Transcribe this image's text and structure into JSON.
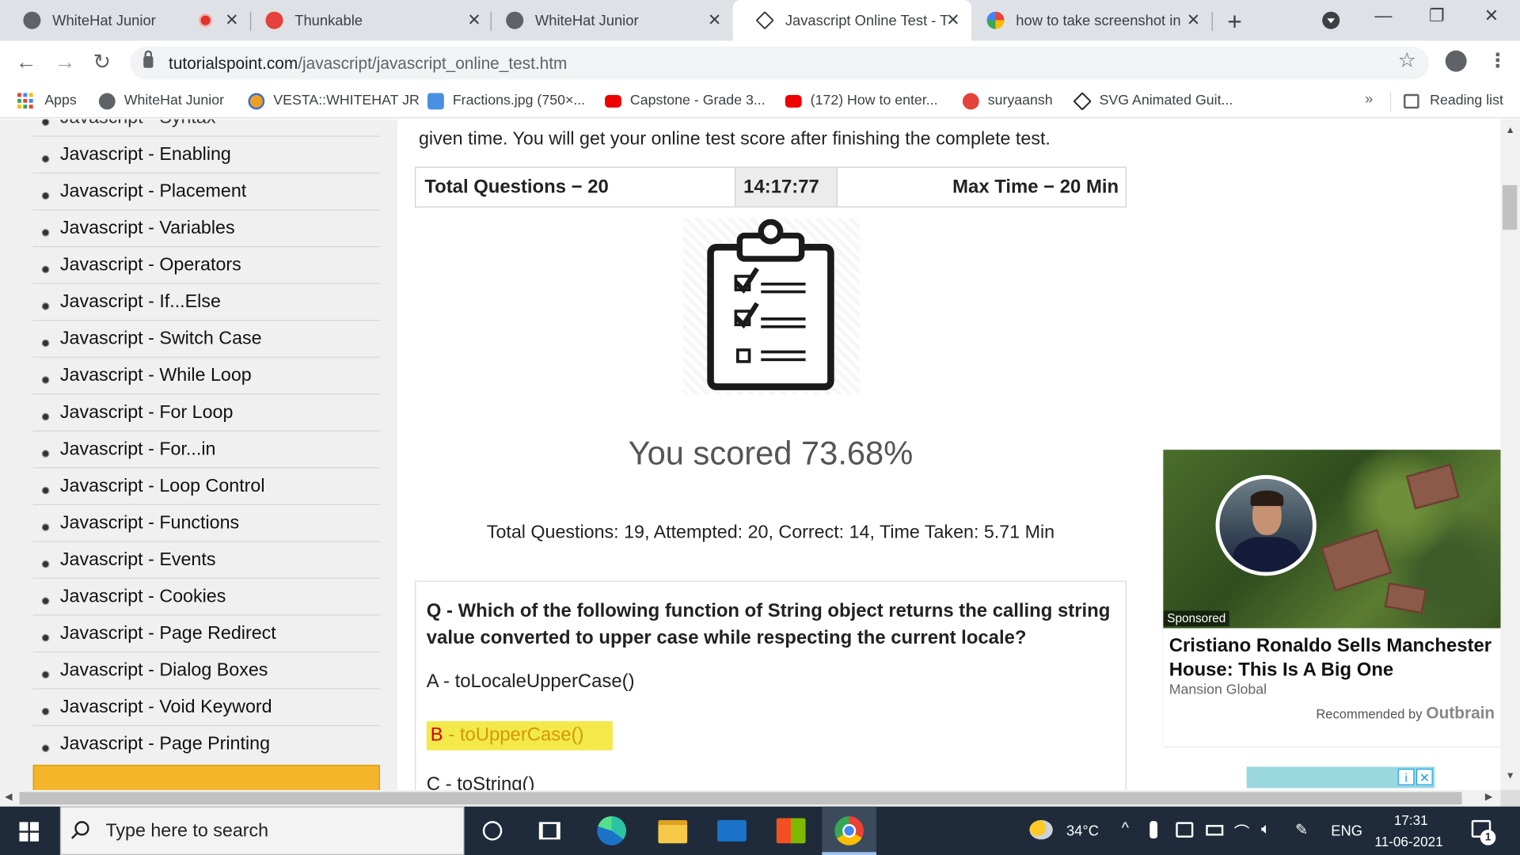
{
  "browser": {
    "tabs": [
      {
        "title": "WhiteHat Junior",
        "active": false,
        "recording": true
      },
      {
        "title": "Thunkable",
        "active": false
      },
      {
        "title": "WhiteHat Junior",
        "active": false
      },
      {
        "title": "Javascript Online Test - Tu",
        "active": true
      },
      {
        "title": "how to take screenshot in",
        "active": false
      }
    ],
    "new_tab": "+",
    "window_controls": {
      "minimize": "—",
      "restore": "❐",
      "close": "✕"
    },
    "url_host": "tutorialspoint.com",
    "url_path": "/javascript/javascript_online_test.htm",
    "bookmarks": [
      {
        "label": "Apps"
      },
      {
        "label": "WhiteHat Junior"
      },
      {
        "label": "VESTA::WHITEHAT JR"
      },
      {
        "label": "Fractions.jpg (750×..."
      },
      {
        "label": "Capstone - Grade 3..."
      },
      {
        "label": "(172) How to enter..."
      },
      {
        "label": "suryaansh"
      },
      {
        "label": "SVG Animated Guit..."
      }
    ],
    "bookmarks_more": "»",
    "reading_list": "Reading list"
  },
  "sidebar": {
    "items": [
      "Javascript - Syntax",
      "Javascript - Enabling",
      "Javascript - Placement",
      "Javascript - Variables",
      "Javascript - Operators",
      "Javascript - If...Else",
      "Javascript - Switch Case",
      "Javascript - While Loop",
      "Javascript - For Loop",
      "Javascript - For...in",
      "Javascript - Loop Control",
      "Javascript - Functions",
      "Javascript - Events",
      "Javascript - Cookies",
      "Javascript - Page Redirect",
      "Javascript - Dialog Boxes",
      "Javascript - Void Keyword",
      "Javascript - Page Printing"
    ]
  },
  "test": {
    "intro": "given time. You will get your online test score after finishing the complete test.",
    "total_questions": "Total Questions − 20",
    "timer": "14:17:77",
    "max_time": "Max Time − 20 Min",
    "score": "You scored 73.68%",
    "stats": "Total Questions: 19, Attempted: 20, Correct: 14, Time Taken: 5.71 Min",
    "question": "Q - Which of the following function of String object returns the calling string value converted to upper case while respecting the current locale?",
    "option_a": "A - toLocaleUpperCase()",
    "option_b_key": "B",
    "option_b_value": " - toUpperCase()",
    "option_c": "C - toString()"
  },
  "ad": {
    "sponsored": "Sponsored",
    "title": "Cristiano Ronaldo Sells Manchester House: This Is A Big One",
    "source": "Mansion Global",
    "recommended_by": "Recommended by",
    "brand": "Outbrain"
  },
  "taskbar": {
    "search_placeholder": "Type here to search",
    "weather": "34°C",
    "language": "ENG",
    "time": "17:31",
    "date": "11-06-2021",
    "notifications": "1"
  },
  "colors": {
    "nav_banner": "#f5b52a",
    "highlight": "#f3e94b",
    "taskbar": "#1f2b3a"
  }
}
